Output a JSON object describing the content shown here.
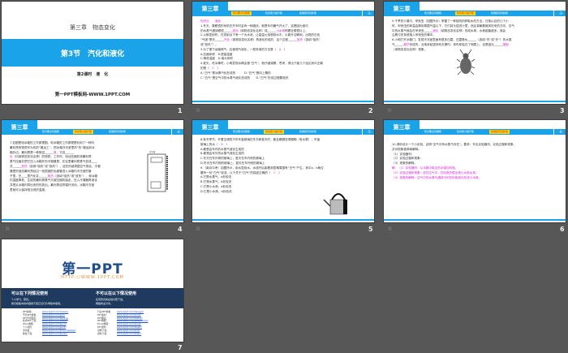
{
  "slide1": {
    "chapter": "第三章　物态变化",
    "section": "第3节　汽化和液化",
    "lesson": "第2课时　液　化",
    "site": "第一PPT模板网-WWW.1PPT.COM",
    "number": "1"
  },
  "template": {
    "chapter_tab": "第三章",
    "tabs": [
      "知识要点基础练",
      "综合能力提升练",
      "拓展探究创新练"
    ]
  },
  "slides": [
    {
      "number": "2",
      "page": "-2-",
      "active_tab": 0,
      "lines": [
        [
          {
            "t": "知识点　　",
            "a": true
          },
          {
            "t": "液化",
            "a": true
          }
        ],
        [
          {
            "t": "1.冬天，戴眼镜的司机在开车时会有一种困扰，就是车内暖气开大了，这是因为室内"
          }
        ],
        [
          {
            "t": "的水蒸气遇到眼镜______"
          },
          {
            "t": "液化",
            "a": true
          },
          {
            "t": "（填物态变化名称）成______"
          },
          {
            "t": "小水珠",
            "a": true
          },
          {
            "t": "附着在眼镜片上。"
          }
        ],
        [
          {
            "t": "2.火箭发射时，在发射台下有一个大水池，让高温火焰喷到水中，火箭升空瞬间，出现的白色"
          }
        ],
        [
          {
            "t": "“气团”是先______"
          },
          {
            "t": "汽化",
            "a": true
          },
          {
            "t": "（填物态变化名称）再液化形成的，这个过程______"
          },
          {
            "t": "放热",
            "a": true
          },
          {
            "t": "（选填“吸热”"
          }
        ],
        [
          {
            "t": "或“放热”）。"
          }
        ],
        [
          {
            "t": "3.为了便于运输燃气，应使燃气液化，一般采用的方法是（　"
          },
          {
            "t": "A",
            "a": true
          },
          {
            "t": "　）"
          }
        ],
        [
          {
            "t": "A.压缩体积　B.提高温度"
          }
        ],
        [
          {
            "t": "C.降低温度　D.增大体积"
          }
        ],
        [
          {
            "t": "4.夏天，吃冰棒时，小明发现冰棒会冒“白气”，他仔细观察，思考，得出下面几个结论其中正确"
          }
        ],
        [
          {
            "t": "的是（　"
          },
          {
            "t": "C",
            "a": true
          },
          {
            "t": "　）"
          }
        ],
        [
          {
            "t": "A.“白气”是冰棒汽化形成的　　　D.“白气”是向上飘的"
          }
        ],
        [
          {
            "t": "C.“白气”是空气中的水蒸气液化形成的　　D.“白气”形成过程要吸热"
          }
        ]
      ]
    },
    {
      "number": "3",
      "page": "-3-",
      "active_tab": 1,
      "lines": [
        [
          {
            "t": "5.干旱的沙漠中，甲壳虫（如图所示）掌握了一种独特的获取水的方法。日落以后的几个小"
          }
        ],
        [
          {
            "t": "时，甲壳虫的体温会降到周围气温以下，它们将头插进沙里，然后背朝着微风吹来的方向，空气"
          }
        ],
        [
          {
            "t": "中的水蒸气就会在甲壳虫______"
          },
          {
            "t": "液化",
            "a": true
          },
          {
            "t": "（填物态变化名称）形成水珠，水珠越聚越多，就会"
          }
        ],
        [
          {
            "t": "沿着弓形背滚落入甲壳虫的嘴中。"
          }
        ],
        [
          {
            "t": " "
          }
        ],
        [
          {
            "t": " "
          }
        ],
        [
          {
            "t": " "
          }
        ],
        [
          {
            "t": " "
          }
        ],
        [
          {
            "t": " "
          }
        ],
        [
          {
            "t": " "
          }
        ],
        [
          {
            "t": " "
          }
        ],
        [
          {
            "t": "6.小明打开冰箱门，发现冷冻室里面有很多白霜，白霜是水______（选填“内”或“外”）的水蒸"
          }
        ],
        [
          {
            "t": "气______"
          },
          {
            "t": "凝华",
            "a": true
          },
          {
            "t": "形成的，当他拿起湿抹布去擦时，抹布却粘在了侧壁上，这是因为______"
          },
          {
            "t": "凝固",
            "a": true
          }
        ],
        [
          {
            "t": "（填物态变化名称）现象。"
          }
        ]
      ]
    },
    {
      "number": "4",
      "page": "-4-",
      "active_tab": 1,
      "lines": [
        [
          {
            "t": "7.如图是电冰箱的工作原理图。电冰箱的工作原理是利用了一种叫"
          }
        ],
        [
          {
            "t": "氟利昂的物质作为热的“搬运工”，把冰箱冷冻室里的“热”搬运到冰"
          }
        ],
        [
          {
            "t": "箱外边。氟利昂是一种既容______"
          },
          {
            "t": "易",
            "a": true
          },
          {
            "t": "，又容______"
          }
        ],
        [
          {
            "t": "化",
            "a": true
          },
          {
            "t": "（均填物态变化名称）的物质。工作时，电动压缩机将氟利昂"
          }
        ],
        [
          {
            "t": "蒸气压缩并把它压入冰箱外的冷凝器里，在这里氟利昂蒸气变成____"
          }
        ],
        [
          {
            "t": "并______"
          },
          {
            "t": "放热",
            "a": true
          },
          {
            "t": "（选填“吸热”或“放热”），这些热被周围空气带走。冷凝"
          }
        ],
        [
          {
            "t": "器里的液态氟利昂经过一段很细的毛细管进入冰箱内冷冻室的管"
          }
        ],
        [
          {
            "t": "子里，在____里汽化并______"
          },
          {
            "t": "吸热",
            "a": true
          },
          {
            "t": "（选填“吸热”或“放热”），使冰箱"
          }
        ],
        [
          {
            "t": "内温度降低，生成的氟利昂蒸气又被压缩机抽走，压入冷凝器再液化"
          }
        ],
        [
          {
            "t": "并把从冰箱内带出来的热放出。氟利昂这样循环流动，冰箱冷冻室"
          }
        ],
        [
          {
            "t": "里就可以保持相当低的温度。"
          }
        ]
      ]
    },
    {
      "number": "5",
      "page": "-5-",
      "active_tab": 1,
      "lines": [
        [
          {
            "t": "8.秋冬季节，开着空调的汽车车窗玻璃在冬天和夏天时，都会模糊变得模糊（有水雾），车窗"
          }
        ],
        [
          {
            "t": "玻璃上的水（　"
          },
          {
            "t": "D",
            "a": true
          },
          {
            "t": "　）"
          }
        ],
        [
          {
            "t": "A.都是由车内的水蒸气液化生成的"
          }
        ],
        [
          {
            "t": "B.都是由车外的水蒸气液化生成的"
          }
        ],
        [
          {
            "t": "C.冬天在车外侧的玻璃上，夏天在车内侧的玻璃上"
          }
        ],
        [
          {
            "t": "D.冬天在车内侧的玻璃上，夏天在车外侧的玻璃上"
          }
        ],
        [
          {
            "t": "9.（南京中考）如图所示，用水壶烧水，水烧开后能看到壶嘴周围有“白气”产生，其中a、b两位"
          }
        ],
        [
          {
            "t": "置有一处“白气”较浓。以下关于“白气”的描述正确的（　"
          },
          {
            "t": "C",
            "a": true
          },
          {
            "t": "　）"
          }
        ],
        [
          {
            "t": " "
          }
        ],
        [
          {
            "t": "A.它是水蒸气，a处较浓"
          }
        ],
        [
          {
            "t": "B.它是水蒸气，b处较浓"
          }
        ],
        [
          {
            "t": "C.它是小水滴，a处较浓"
          }
        ],
        [
          {
            "t": "D.它是小水滴，b处较浓"
          }
        ]
      ]
    },
    {
      "number": "6",
      "page": "-6-",
      "active_tab": 2,
      "lines": [
        [
          {
            "t": " "
          }
        ],
        [
          {
            "t": " "
          }
        ],
        [
          {
            "t": "10.请你设计一个小实验，证明“空气中有水蒸气存在”。要求：写出实验器材、实验过程和现象，"
          }
        ],
        [
          {
            "t": "并对现象做简单解释。"
          }
        ],
        [
          {
            "t": "（1）实验器材："
          }
        ],
        [
          {
            "t": "（2）实验过程和现象："
          }
        ],
        [
          {
            "t": "（3）现象的解释。"
          }
        ],
        [
          {
            "t": "解：（1）实验器材：从冰箱中取出的冰镇饮料瓶。",
            "a": true
          }
        ],
        [
          {
            "t": "（2）实验过程和现象：放在空气中，饮料瓶外壁出现小水珠出现。",
            "a": true
          }
        ],
        [
          {
            "t": "（3）现象的解释：空气中的水蒸气遇到冷的饮料瓶液化形成小水珠。",
            "a": true
          }
        ]
      ]
    }
  ],
  "slide7": {
    "number": "7",
    "logo": "第一PPT",
    "url": "HTTP://WWW.1PPT.COM",
    "can_title": "可以在下列情况使用",
    "can_items": [
      "个人学习、研究。",
      "拷贝模板中的内容用于其它幻灯片母版中使用。"
    ],
    "cannot_title": "不可以在以下情况使用",
    "cannot_items": [
      "任何形式的在线付费下载。",
      "网络商业分享。"
    ],
    "left_links": [
      [
        "PPT模板：",
        "www.1ppt.com/moban/"
      ],
      [
        "节日PPT模板：",
        "www.1ppt.com/jieri/"
      ],
      [
        "PPT背景图片：",
        "www.1ppt.com/beijing/"
      ],
      [
        "优秀PPT下载：",
        "www.1ppt.com/xiazai/"
      ],
      [
        "Word教程：",
        "www.1ppt.com/word/"
      ],
      [
        "个人简历：",
        "www.1ppt.com/jianli/"
      ],
      [
        "手抄报：",
        "www.1ppt.com/shouchaobao/"
      ],
      [
        "教案下载：",
        "www.1ppt.com/jiaoan/"
      ]
    ],
    "right_links": [
      [
        "行业PPT模板：",
        "www.1ppt.com/hangye/"
      ],
      [
        "PPT素材：",
        "www.1ppt.com/sucai/"
      ],
      [
        "PPT图表：",
        "www.1ppt.com/tubiao/"
      ],
      [
        "PPT教程：",
        "www.1ppt.com/powerpoint/"
      ],
      [
        "Excel教程：",
        "www.1ppt.com/excel/"
      ],
      [
        "PPT课件：",
        "www.1ppt.com/kejian/"
      ],
      [
        "试卷下载：",
        "www.1ppt.com/shiti/"
      ],
      [
        "资料下载：",
        "www.1ppt.com/ziliao/"
      ]
    ]
  },
  "colors": {
    "accent": "#1aa3e8",
    "answer": "#e020e0",
    "highlight": "#ffd200",
    "navy": "#1f3a5f"
  }
}
